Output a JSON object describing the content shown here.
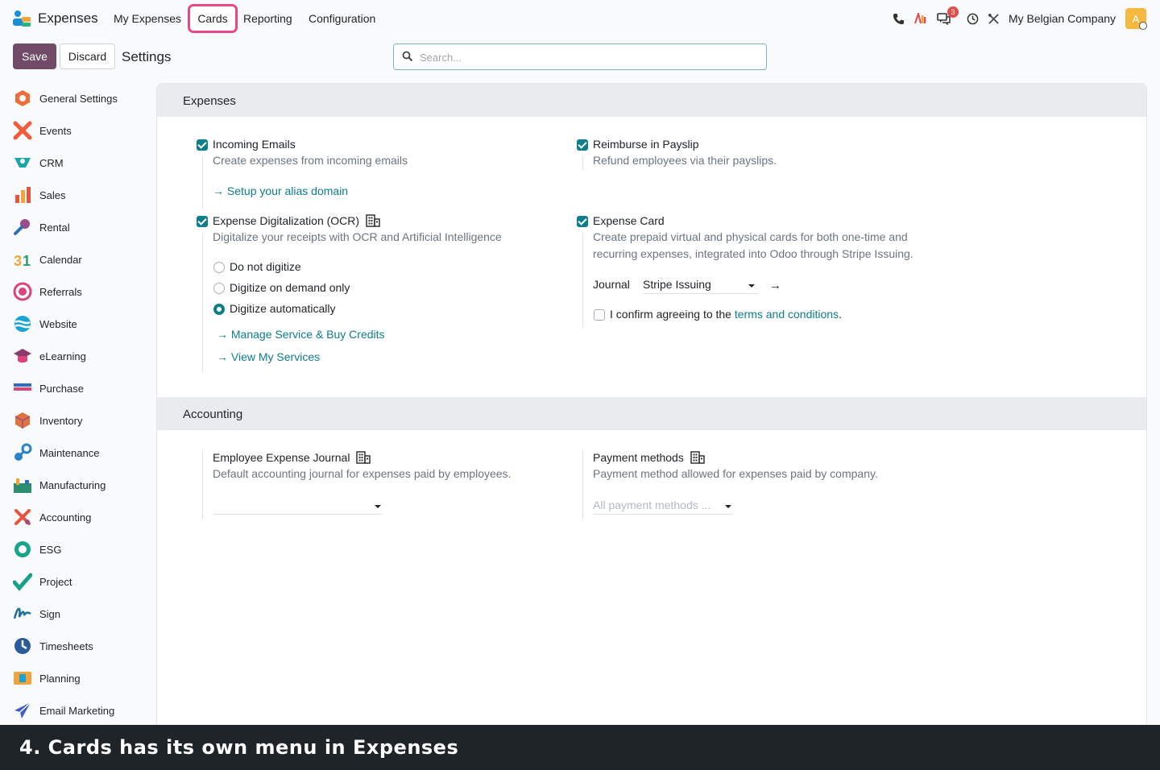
{
  "navbar": {
    "app_name": "Expenses",
    "menu": [
      "My Expenses",
      "Cards",
      "Reporting",
      "Configuration"
    ],
    "notification_count": "3",
    "company": "My Belgian Company",
    "avatar_letter": "A"
  },
  "control_panel": {
    "save_label": "Save",
    "discard_label": "Discard",
    "title": "Settings",
    "search_placeholder": "Search..."
  },
  "sidebar": {
    "items": [
      {
        "label": "General Settings",
        "icon": "general-settings-icon",
        "color": "#f06b3a"
      },
      {
        "label": "Events",
        "icon": "events-icon",
        "color": "#f25a3a"
      },
      {
        "label": "CRM",
        "icon": "crm-icon",
        "color": "#1aa7a3"
      },
      {
        "label": "Sales",
        "icon": "sales-icon",
        "color": "#e7533b"
      },
      {
        "label": "Rental",
        "icon": "rental-icon",
        "color": "#9b4c8b"
      },
      {
        "label": "Calendar",
        "icon": "calendar-icon",
        "color": "#f2a33a"
      },
      {
        "label": "Referrals",
        "icon": "referrals-icon",
        "color": "#d9447d"
      },
      {
        "label": "Website",
        "icon": "website-icon",
        "color": "#1ba3d3"
      },
      {
        "label": "eLearning",
        "icon": "elearning-icon",
        "color": "#8a3b6d"
      },
      {
        "label": "Purchase",
        "icon": "purchase-icon",
        "color": "#2e6fb5"
      },
      {
        "label": "Inventory",
        "icon": "inventory-icon",
        "color": "#e0733a"
      },
      {
        "label": "Maintenance",
        "icon": "maintenance-icon",
        "color": "#2a83c9"
      },
      {
        "label": "Manufacturing",
        "icon": "manufacturing-icon",
        "color": "#2c8e6e"
      },
      {
        "label": "Accounting",
        "icon": "accounting-icon",
        "color": "#e7533b"
      },
      {
        "label": "ESG",
        "icon": "esg-icon",
        "color": "#17a589"
      },
      {
        "label": "Project",
        "icon": "project-icon",
        "color": "#1b9f8a"
      },
      {
        "label": "Sign",
        "icon": "sign-icon",
        "color": "#1b6f9b"
      },
      {
        "label": "Timesheets",
        "icon": "timesheets-icon",
        "color": "#2a5b9b"
      },
      {
        "label": "Planning",
        "icon": "planning-icon",
        "color": "#f2a33a"
      },
      {
        "label": "Email Marketing",
        "icon": "email-marketing-icon",
        "color": "#3b5ccc"
      }
    ]
  },
  "expenses_section": {
    "title": "Expenses",
    "incoming_emails": {
      "title": "Incoming Emails",
      "desc": "Create expenses from incoming emails",
      "link": "Setup your alias domain"
    },
    "reimburse": {
      "title": "Reimburse in Payslip",
      "desc": "Refund employees via their payslips."
    },
    "ocr": {
      "title": "Expense Digitalization (OCR)",
      "desc": "Digitalize your receipts with OCR and Artificial Intelligence",
      "options": [
        "Do not digitize",
        "Digitize on demand only",
        "Digitize automatically"
      ],
      "selected": "Digitize automatically",
      "link1": "Manage Service & Buy Credits",
      "link2": "View My Services"
    },
    "expense_card": {
      "title": "Expense Card",
      "desc_line1": "Create prepaid virtual and physical cards for both one-time and",
      "desc_line2": "recurring expenses, integrated into Odoo through Stripe Issuing.",
      "journal_label": "Journal",
      "journal_value": "Stripe Issuing",
      "confirm_text": "I confirm agreeing to the",
      "terms_link": "terms and conditions",
      "period": "."
    }
  },
  "accounting_section": {
    "title": "Accounting",
    "journal": {
      "title": "Employee Expense Journal",
      "desc": "Default accounting journal for expenses paid by employees.",
      "value": ""
    },
    "payment": {
      "title": "Payment methods",
      "desc": "Payment method allowed for expenses paid by company.",
      "placeholder": "All payment methods ..."
    }
  },
  "caption": "4. Cards has its own menu in Expenses",
  "colors": {
    "brand": "#714b67",
    "accent": "#0f7d8c",
    "highlight": "#e5498a"
  }
}
